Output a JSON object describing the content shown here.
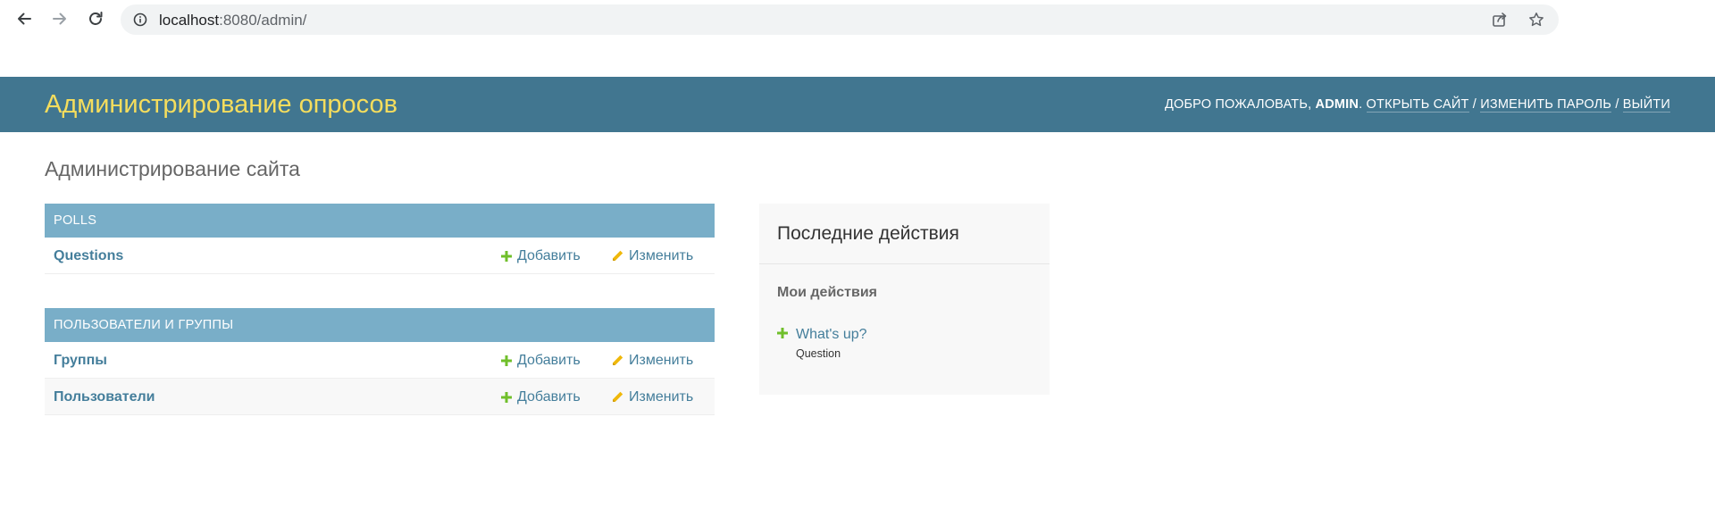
{
  "browser": {
    "url_host": "localhost",
    "url_path": ":8080/admin/"
  },
  "header": {
    "branding": "Администрирование опросов",
    "welcome": "ДОБРО ПОЖАЛОВАТЬ,",
    "username": "ADMIN",
    "sep_dot": ".",
    "view_site": "ОТКРЫТЬ САЙТ",
    "change_password": "ИЗМЕНИТЬ ПАРОЛЬ",
    "logout": "ВЫЙТИ",
    "separator": "/"
  },
  "content": {
    "title": "Администрирование сайта",
    "add_label": "Добавить",
    "change_label": "Изменить",
    "apps": [
      {
        "caption": "POLLS",
        "models": [
          {
            "name": "Questions"
          }
        ]
      },
      {
        "caption": "ПОЛЬЗОВАТЕЛИ И ГРУППЫ",
        "models": [
          {
            "name": "Группы"
          },
          {
            "name": "Пользователи"
          }
        ]
      }
    ]
  },
  "recent_actions": {
    "title": "Последние действия",
    "subtitle": "Мои действия",
    "items": [
      {
        "label": "What's up?",
        "type": "Question",
        "action": "add"
      }
    ]
  },
  "colors": {
    "header_bg": "#417690",
    "branding": "#f5dd5d",
    "caption_bg": "#79aec8",
    "link": "#447e9b",
    "add_icon": "#70bf2b",
    "change_icon": "#efb80b"
  },
  "icons": {
    "back": "arrow-left-icon",
    "forward": "arrow-right-icon",
    "reload": "reload-icon",
    "site_info": "info-icon",
    "share": "share-icon",
    "bookmark": "star-icon",
    "add": "plus-icon",
    "change": "pencil-icon"
  }
}
